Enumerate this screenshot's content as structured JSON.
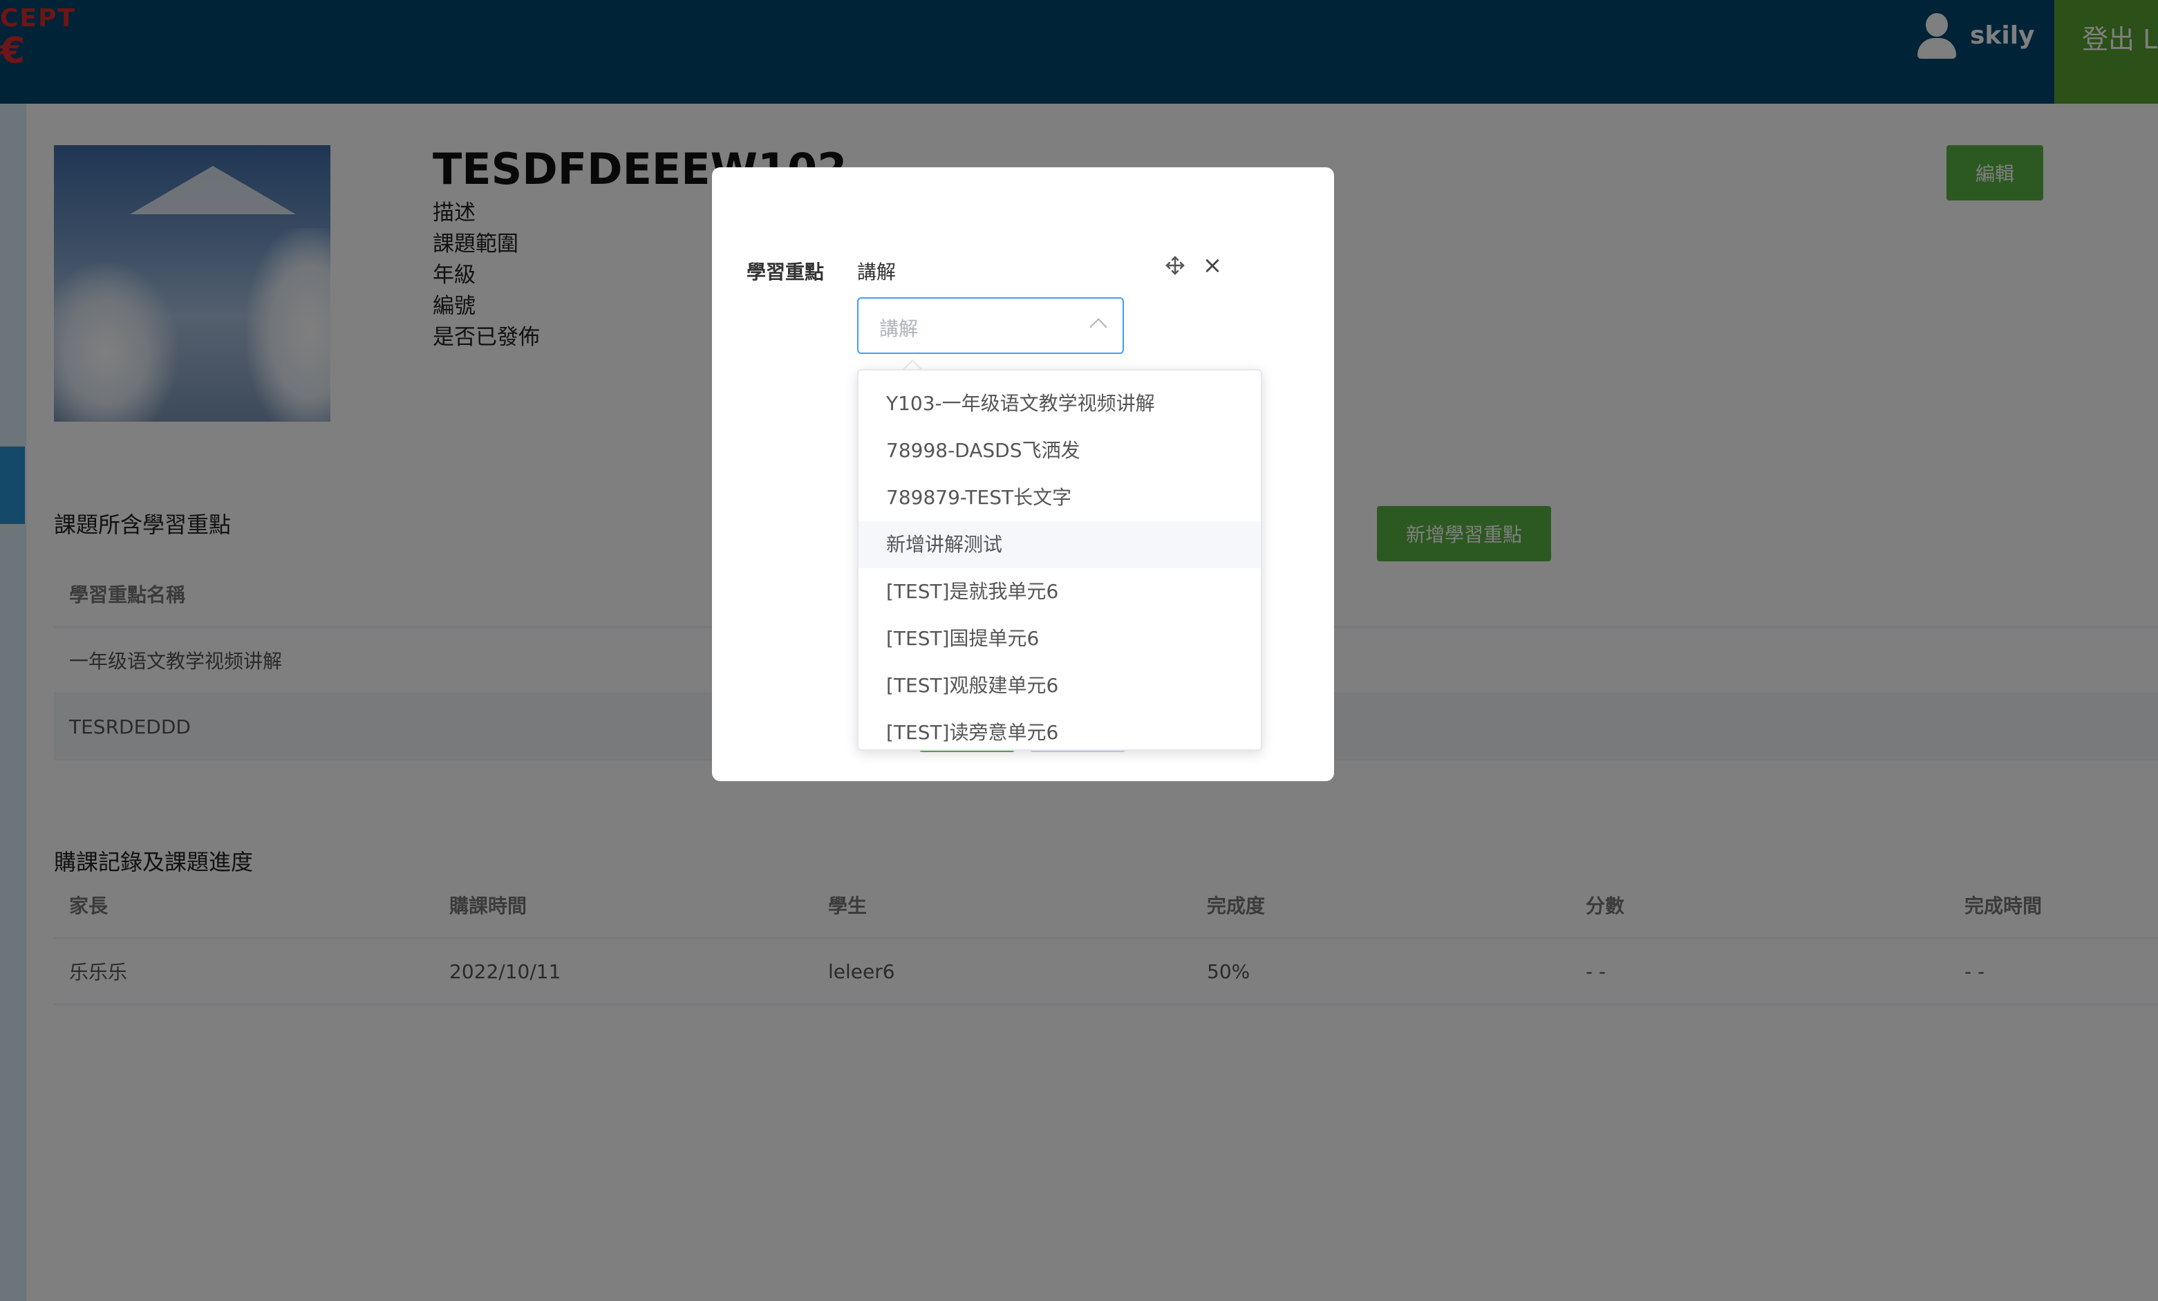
{
  "header": {
    "logo_top": "CEPT",
    "logo_bottom": "€",
    "user_name": "skily",
    "logout_label": "登出 L"
  },
  "course": {
    "title": "TESDFDEEEW102",
    "meta": [
      "描述",
      "課題範圍",
      "年級",
      "編號",
      "是否已發佈"
    ],
    "edit_label": "編輯"
  },
  "focus_section": {
    "title": "課題所含學習重點",
    "add_label": "新增學習重點",
    "column_header": "學習重點名稱",
    "rows": [
      "一年级语文教学视频讲解",
      "TESRDEDDD"
    ]
  },
  "purchase_section": {
    "title": "購課記錄及課題進度",
    "columns": [
      "家長",
      "購課時間",
      "學生",
      "完成度",
      "分數",
      "完成時間"
    ],
    "rows": [
      [
        "乐乐乐",
        "2022/10/11",
        "leleer6",
        "50%",
        "- -",
        "- -"
      ]
    ]
  },
  "modal": {
    "label": "學習重點",
    "selected_type": "講解",
    "select_placeholder": "講解",
    "options": [
      "Y103-一年级语文教学视频讲解",
      "78998-DASDS飞洒发",
      "789879-TEST长文字",
      "新增讲解测试",
      "[TEST]是就我单元6",
      "[TEST]国提单元6",
      "[TEST]观般建单元6",
      "[TEST]读旁意单元6"
    ],
    "hover_option_index": 3
  },
  "icons": {
    "user": "user-icon",
    "move": "move-icon",
    "close": "close-icon",
    "chevron": "chevron-up-icon"
  },
  "colors": {
    "header_bg": "#00466e",
    "primary_green": "#58b342",
    "logout_bg": "#56a030",
    "logo_red": "#e0282e",
    "focus_border": "#409eff"
  }
}
